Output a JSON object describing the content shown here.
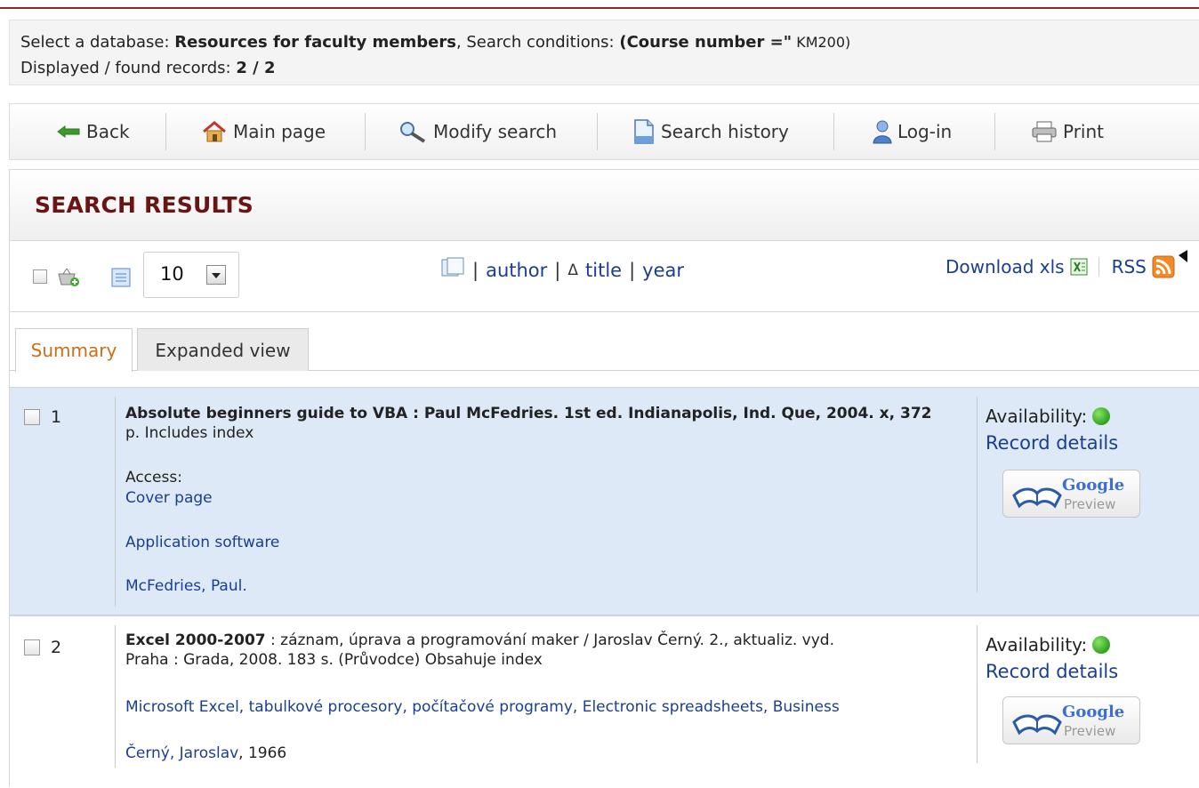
{
  "info": {
    "select_label": "Select a database: ",
    "database": "Resources for faculty members",
    "cond_label": ", Search conditions: ",
    "condition_main": "(Course number =\"",
    "condition_value": " KM200)",
    "displayed_label": "Displayed / found records: ",
    "displayed_value": "2 / 2"
  },
  "toolbar": {
    "back": "Back",
    "main_page": "Main page",
    "modify_search": "Modify search",
    "search_history": "Search history",
    "login": "Log-in",
    "print": "Print"
  },
  "results": {
    "title": "SEARCH RESULTS",
    "per_page": "10",
    "sort": {
      "author": "author",
      "title": "title",
      "year": "year",
      "sep": "|",
      "triangle": "Δ"
    },
    "download": "Download xls",
    "rss": "RSS"
  },
  "tabs": {
    "summary": "Summary",
    "expanded": "Expanded view"
  },
  "records": [
    {
      "number": "1",
      "title": "Absolute beginners guide to VBA : Paul McFedries. 1st ed. Indianapolis, Ind. Que, 2004. x, 372",
      "title_line2": "p. Includes index",
      "access_label": "Access:",
      "cover": "Cover page",
      "subject": "Application software",
      "author": "McFedries, Paul.",
      "availability": "Availability:",
      "details": "Record details"
    },
    {
      "number": "2",
      "title_bold": "Excel 2000-2007",
      "title_rest": " : záznam, úprava a programování maker / Jaroslav Černý. 2., aktualiz. vyd.",
      "title_line2": "Praha : Grada, 2008. 183 s. (Průvodce) Obsahuje index",
      "subjects": "Microsoft Excel, tabulkové procesory, počítačové programy, Electronic spreadsheets, Business",
      "author": "Černý, Jaroslav",
      "author_year": ", 1966",
      "availability": "Availability:",
      "details": "Record details"
    }
  ],
  "google": {
    "brand": "Google",
    "preview": "Preview"
  },
  "colors": {
    "title": "#6b1414",
    "link": "#1a3f8f",
    "active_tab": "#d06d12",
    "record_bg": "#dde9f6",
    "available": "#2ea21c"
  }
}
